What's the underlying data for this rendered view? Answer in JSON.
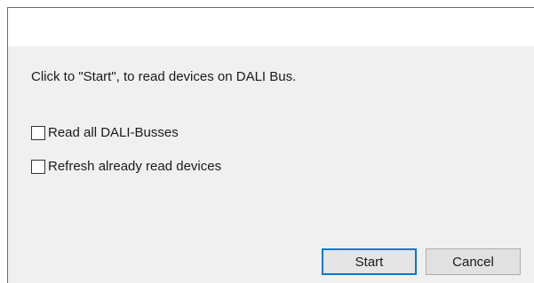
{
  "dialog": {
    "instruction": "Click to \"Start\", to read devices on DALI Bus.",
    "options": [
      {
        "label": "Read all DALI-Busses",
        "checked": false
      },
      {
        "label": "Refresh already read devices",
        "checked": false
      }
    ],
    "buttons": {
      "start_label": "Start",
      "cancel_label": "Cancel"
    }
  },
  "colors": {
    "dialog_background": "#f0f0f0",
    "default_button_border": "#0078d7"
  }
}
